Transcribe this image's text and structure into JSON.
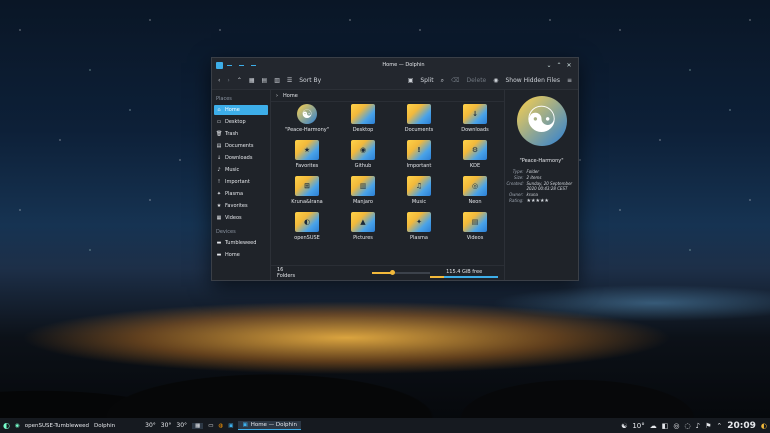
{
  "window": {
    "title": "Home — Dolphin",
    "toolbar": {
      "sort_by": "Sort By",
      "split": "Split",
      "delete": "Delete",
      "show_hidden": "Show Hidden Files"
    },
    "breadcrumb": "Home",
    "places_header": "Places",
    "devices_header": "Devices",
    "places": [
      {
        "label": "Home",
        "icon": "⌂",
        "active": true
      },
      {
        "label": "Desktop",
        "icon": "▭"
      },
      {
        "label": "Trash",
        "icon": "🗑"
      },
      {
        "label": "Documents",
        "icon": "▤"
      },
      {
        "label": "Downloads",
        "icon": "↓"
      },
      {
        "label": "Music",
        "icon": "♪"
      },
      {
        "label": "Important",
        "icon": "!"
      },
      {
        "label": "Plasma",
        "icon": "✦"
      },
      {
        "label": "Favorites",
        "icon": "★"
      },
      {
        "label": "Videos",
        "icon": "▦"
      }
    ],
    "devices": [
      {
        "label": "Tumbleweed",
        "icon": "▬"
      },
      {
        "label": "Home",
        "icon": "▬"
      }
    ],
    "items": [
      {
        "label": "\"Peace-Harmony\"",
        "symbol": "☯"
      },
      {
        "label": "Desktop",
        "symbol": ""
      },
      {
        "label": "Documents",
        "symbol": ""
      },
      {
        "label": "Downloads",
        "symbol": "↓"
      },
      {
        "label": "Favorites",
        "symbol": "★"
      },
      {
        "label": "Github",
        "symbol": "◉"
      },
      {
        "label": "Important",
        "symbol": "!"
      },
      {
        "label": "KDE",
        "symbol": "⚙"
      },
      {
        "label": "Kruna&Irana",
        "symbol": "⊞"
      },
      {
        "label": "Manjaro",
        "symbol": "▥"
      },
      {
        "label": "Music",
        "symbol": "♫"
      },
      {
        "label": "Neon",
        "symbol": "◎"
      },
      {
        "label": "openSUSE",
        "symbol": "◐"
      },
      {
        "label": "Pictures",
        "symbol": "▲"
      },
      {
        "label": "Plasma",
        "symbol": "✦"
      },
      {
        "label": "Videos",
        "symbol": "▤"
      }
    ],
    "status": {
      "count": "16 Folders",
      "free": "115.4 GiB free",
      "zoom_fraction": 0.35,
      "used_fraction": 0.2
    },
    "info": {
      "name": "\"Peace-Harmony\"",
      "type_k": "Type:",
      "type_v": "Folder",
      "size_k": "Size:",
      "size_v": "2 items",
      "created_k": "Created:",
      "created_v": "Sunday, 20 September 2020 00:43:28 CEST",
      "owner_k": "Owner:",
      "owner_v": "kruna",
      "rating_k": "Rating:",
      "rating_v": "★★★★★"
    }
  },
  "taskbar": {
    "os": "openSUSE-Tumbleweed",
    "dolphin": "Dolphin",
    "temps": [
      "30°",
      "30°",
      "30°"
    ],
    "active_task": "Home — Dolphin",
    "weather": "10°",
    "clock": "20:09"
  },
  "colors": {
    "accent": "#3daee9",
    "folder_gold": "#f2b93b"
  }
}
